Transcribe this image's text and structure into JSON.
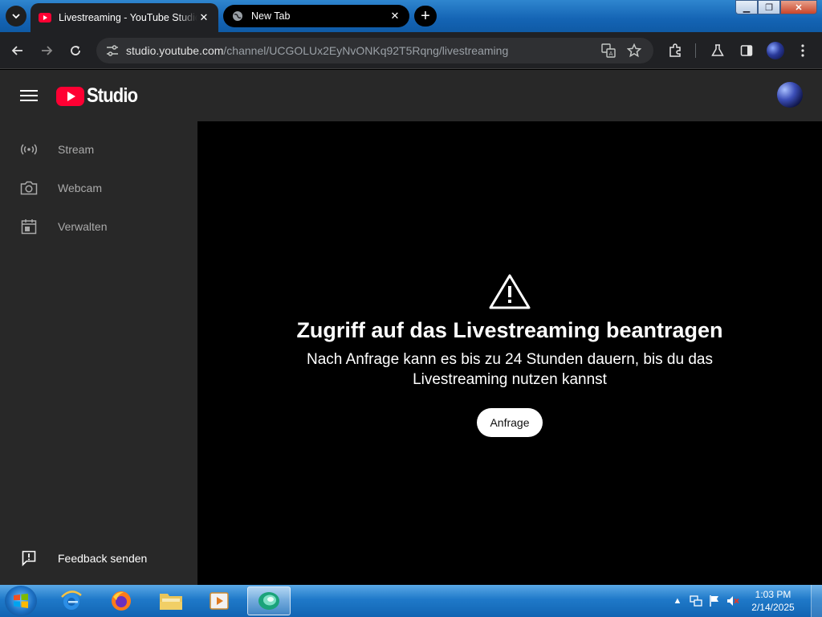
{
  "browser": {
    "tabs": [
      {
        "title": "Livestreaming - YouTube Studio",
        "active": true
      },
      {
        "title": "New Tab",
        "active": false
      }
    ],
    "url_host": "studio.youtube.com",
    "url_path": "/channel/UCGOLUx2EyNvONKq92T5Rqng/livestreaming"
  },
  "studio": {
    "logo_text": "Studio"
  },
  "sidebar": {
    "items": [
      {
        "label": "Stream",
        "icon": "broadcast-icon"
      },
      {
        "label": "Webcam",
        "icon": "camera-icon"
      },
      {
        "label": "Verwalten",
        "icon": "calendar-icon"
      }
    ],
    "feedback_label": "Feedback senden"
  },
  "main": {
    "headline": "Zugriff auf das Livestreaming beantragen",
    "description": "Nach Anfrage kann es bis zu 24 Stunden dauern, bis du das Livestreaming nutzen kannst",
    "request_button": "Anfrage"
  },
  "taskbar": {
    "time": "1:03 PM",
    "date": "2/14/2025"
  },
  "colors": {
    "youtube_red": "#ff0033",
    "sidebar_bg": "#282828",
    "main_bg": "#000000",
    "taskbar_blue": "#1f79c9"
  }
}
